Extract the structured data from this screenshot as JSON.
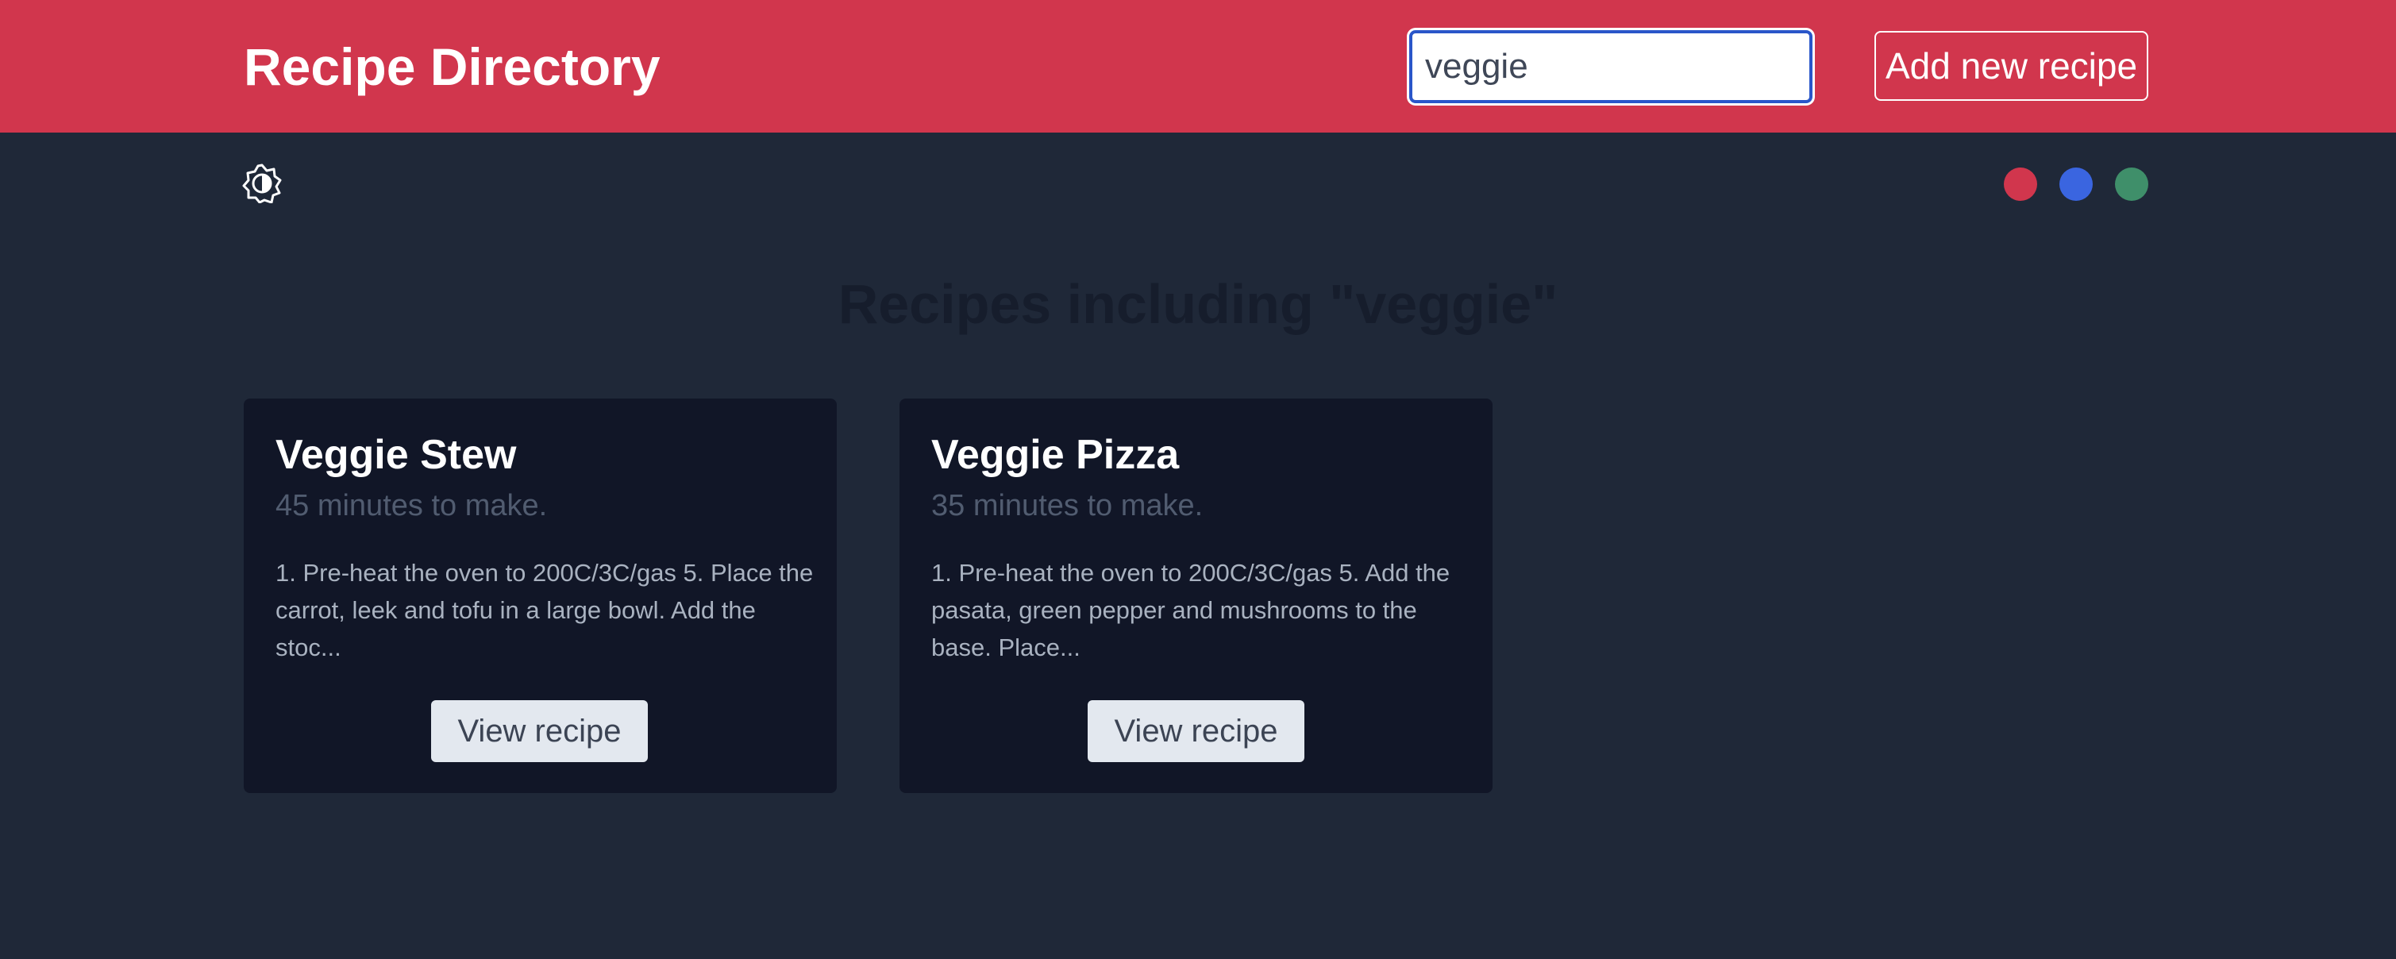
{
  "header": {
    "title": "Recipe Directory",
    "search_value": "veggie",
    "add_button_label": "Add new recipe",
    "background_color": "#d1364d"
  },
  "toolbar": {
    "theme_toggle_icon": "brightness-contrast-icon",
    "theme_colors": [
      {
        "name": "red",
        "hex": "#d1364d"
      },
      {
        "name": "blue",
        "hex": "#3a65e0"
      },
      {
        "name": "green",
        "hex": "#3f8f6a"
      }
    ]
  },
  "main": {
    "heading": "Recipes including \"veggie\"",
    "recipes": [
      {
        "title": "Veggie Stew",
        "time": "45 minutes to make.",
        "description": "1. Pre-heat the oven to 200C/3C/gas 5. Place the carrot, leek and tofu in a large bowl. Add the stoc...",
        "button_label": "View recipe"
      },
      {
        "title": "Veggie Pizza",
        "time": "35 minutes to make.",
        "description": "1. Pre-heat the oven to 200C/3C/gas 5. Add the pasata, green pepper and mushrooms to the base. Place...",
        "button_label": "View recipe"
      }
    ]
  },
  "colors": {
    "page_background": "#1f2838",
    "card_background": "#111627"
  }
}
